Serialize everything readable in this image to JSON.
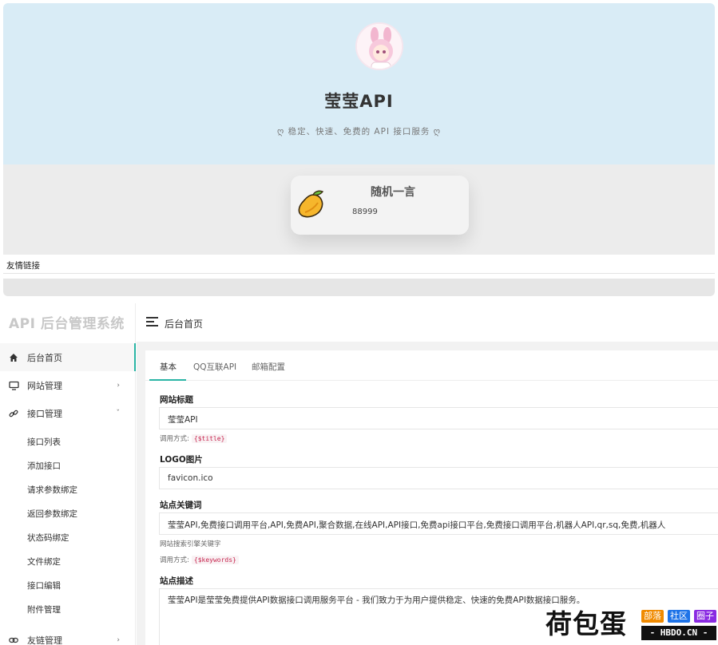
{
  "preview": {
    "site_title": "莹莹API",
    "site_subtitle": "ღ 稳定、快速、免费的 API 接口服务 ღ",
    "quote_title": "随机一言",
    "quote_text": "88999",
    "friend_links_label": "友情链接"
  },
  "admin": {
    "brand": "API 后台管理系统",
    "page_title": "后台首页",
    "nav": [
      {
        "label": "后台首页",
        "icon": "home-icon"
      },
      {
        "label": "网站管理",
        "icon": "monitor-icon"
      },
      {
        "label": "接口管理",
        "icon": "link-icon"
      }
    ],
    "nav_more": {
      "label": "友链管理",
      "icon": "link-icon"
    },
    "sub_nav": [
      "接口列表",
      "添加接口",
      "请求参数绑定",
      "返回参数绑定",
      "状态码绑定",
      "文件绑定",
      "接口编辑",
      "附件管理"
    ],
    "tabs": [
      "基本",
      "QQ互联API",
      "邮箱配置"
    ],
    "fields": {
      "site_title_label": "网站标题",
      "site_title_value": "莹莹API",
      "site_title_call": "调用方式:",
      "site_title_code": "{$title}",
      "logo_label": "LOGO图片",
      "logo_value": "favicon.ico",
      "keywords_label": "站点关键词",
      "keywords_value": "莹莹API,免费接口调用平台,API,免费API,聚合数据,在线API,API接口,免费api接口平台,免费接口调用平台,机器人API,qr,sq,免费,机器人",
      "keywords_hint": "网站搜索引擎关键字",
      "keywords_call": "调用方式:",
      "keywords_code": "{$keywords}",
      "desc_label": "站点描述",
      "desc_value": "莹莹API是莹莹免费提供API数据接口调用服务平台 - 我们致力于为用户提供稳定、快速的免费API数据接口服务。"
    }
  },
  "watermark": {
    "main": "荷包蛋",
    "tags": [
      "部落",
      "社区",
      "圈子"
    ],
    "url": "- HBDO.CN -"
  },
  "colors": {
    "hero_bg": "#d9ecf6",
    "accent": "#2ab5a5",
    "tag_orange": "#f08a00",
    "tag_blue": "#1e73e8",
    "tag_purple": "#8a2be2"
  }
}
